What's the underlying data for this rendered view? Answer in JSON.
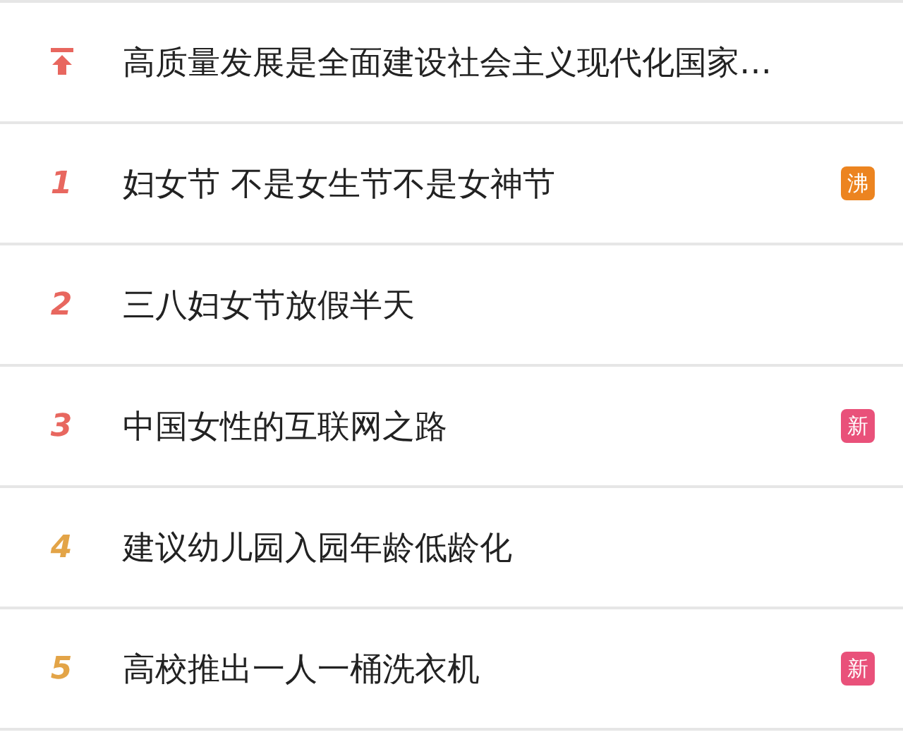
{
  "hot_list": [
    {
      "kind": "pinned",
      "title": "高质量发展是全面建设社会主义现代化国家…",
      "color": "#e8675f"
    },
    {
      "kind": "ranked",
      "rank": "1",
      "color": "#e8675f",
      "title": "妇女节 不是女生节不是女神节",
      "badge": {
        "text": "沸",
        "color": "#ec8420"
      }
    },
    {
      "kind": "ranked",
      "rank": "2",
      "color": "#e8675f",
      "title": "三八妇女节放假半天"
    },
    {
      "kind": "ranked",
      "rank": "3",
      "color": "#e8675f",
      "title": "中国女性的互联网之路",
      "badge": {
        "text": "新",
        "color": "#e9517a"
      }
    },
    {
      "kind": "ranked",
      "rank": "4",
      "color": "#e3a447",
      "title": "建议幼儿园入园年龄低龄化"
    },
    {
      "kind": "ranked",
      "rank": "5",
      "color": "#e3a447",
      "title": "高校推出一人一桶洗衣机",
      "badge": {
        "text": "新",
        "color": "#e9517a"
      }
    }
  ]
}
